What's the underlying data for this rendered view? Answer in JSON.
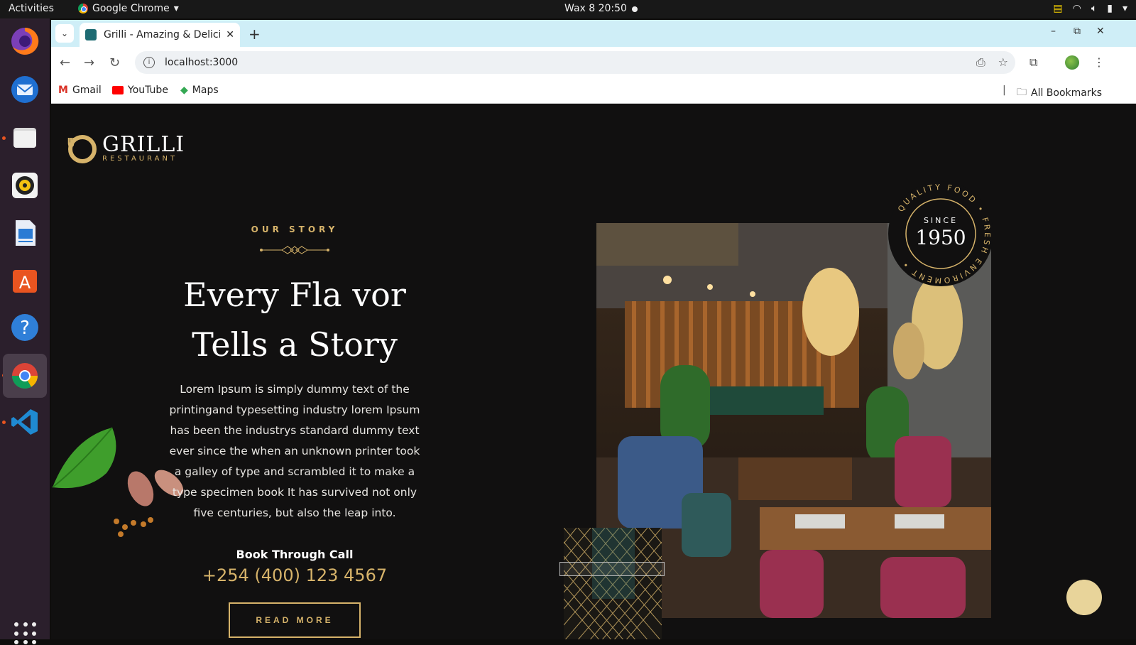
{
  "system": {
    "activities": "Activities",
    "app_name": "Google Chrome",
    "clock": "Wax 8  20:50"
  },
  "browser": {
    "tab_title": "Grilli - Amazing & Delicio",
    "url": "localhost:3000",
    "bookmarks": [
      "Gmail",
      "YouTube",
      "Maps"
    ],
    "all_bookmarks": "All Bookmarks"
  },
  "page": {
    "logo": {
      "name": "GRILLI",
      "sub": "RESTAURANT"
    },
    "story": {
      "subtitle": "OUR STORY",
      "headline_line1": "Every Fla vor",
      "headline_line2": "Tells a Story",
      "body": "Lorem Ipsum is simply dummy text of the printingand typesetting industry lorem Ipsum has been the industrys standard dummy text ever since the when an unknown printer took a galley of type and scrambled it to make a type specimen book It has survived not only five centuries, but also the leap into.",
      "book_label": "Book Through Call",
      "phone": "+254 (400) 123 4567",
      "button": "READ MORE"
    },
    "badge": {
      "since": "SINCE",
      "year": "1950",
      "ring": "QUALITY FOOD • FRESH ENVIROMENT •"
    },
    "colors": {
      "gold": "#d6b36a",
      "background": "#111010"
    }
  }
}
